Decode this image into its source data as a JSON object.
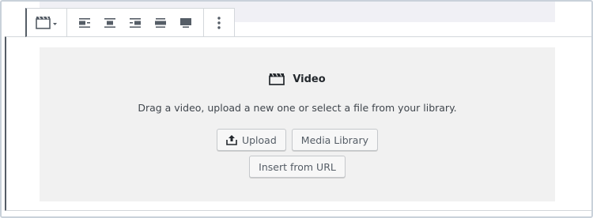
{
  "toolbar": {
    "switcher_icon": "video-icon",
    "align_buttons": [
      {
        "icon": "align-left-icon"
      },
      {
        "icon": "align-center-icon"
      },
      {
        "icon": "align-right-icon"
      },
      {
        "icon": "align-wide-icon"
      },
      {
        "icon": "align-full-icon"
      }
    ],
    "more_icon": "more-options-icon"
  },
  "placeholder": {
    "title": "Video",
    "title_icon": "video-icon",
    "instructions": "Drag a video, upload a new one or select a file from your library.",
    "upload_label": "Upload",
    "upload_icon": "upload-icon",
    "media_library_label": "Media Library",
    "insert_url_label": "Insert from URL"
  },
  "colors": {
    "placeholder_bg": "#f1f1f1",
    "toolbar_border": "#555d66",
    "button_bg": "#f7f7f7",
    "button_text": "#555d66"
  }
}
